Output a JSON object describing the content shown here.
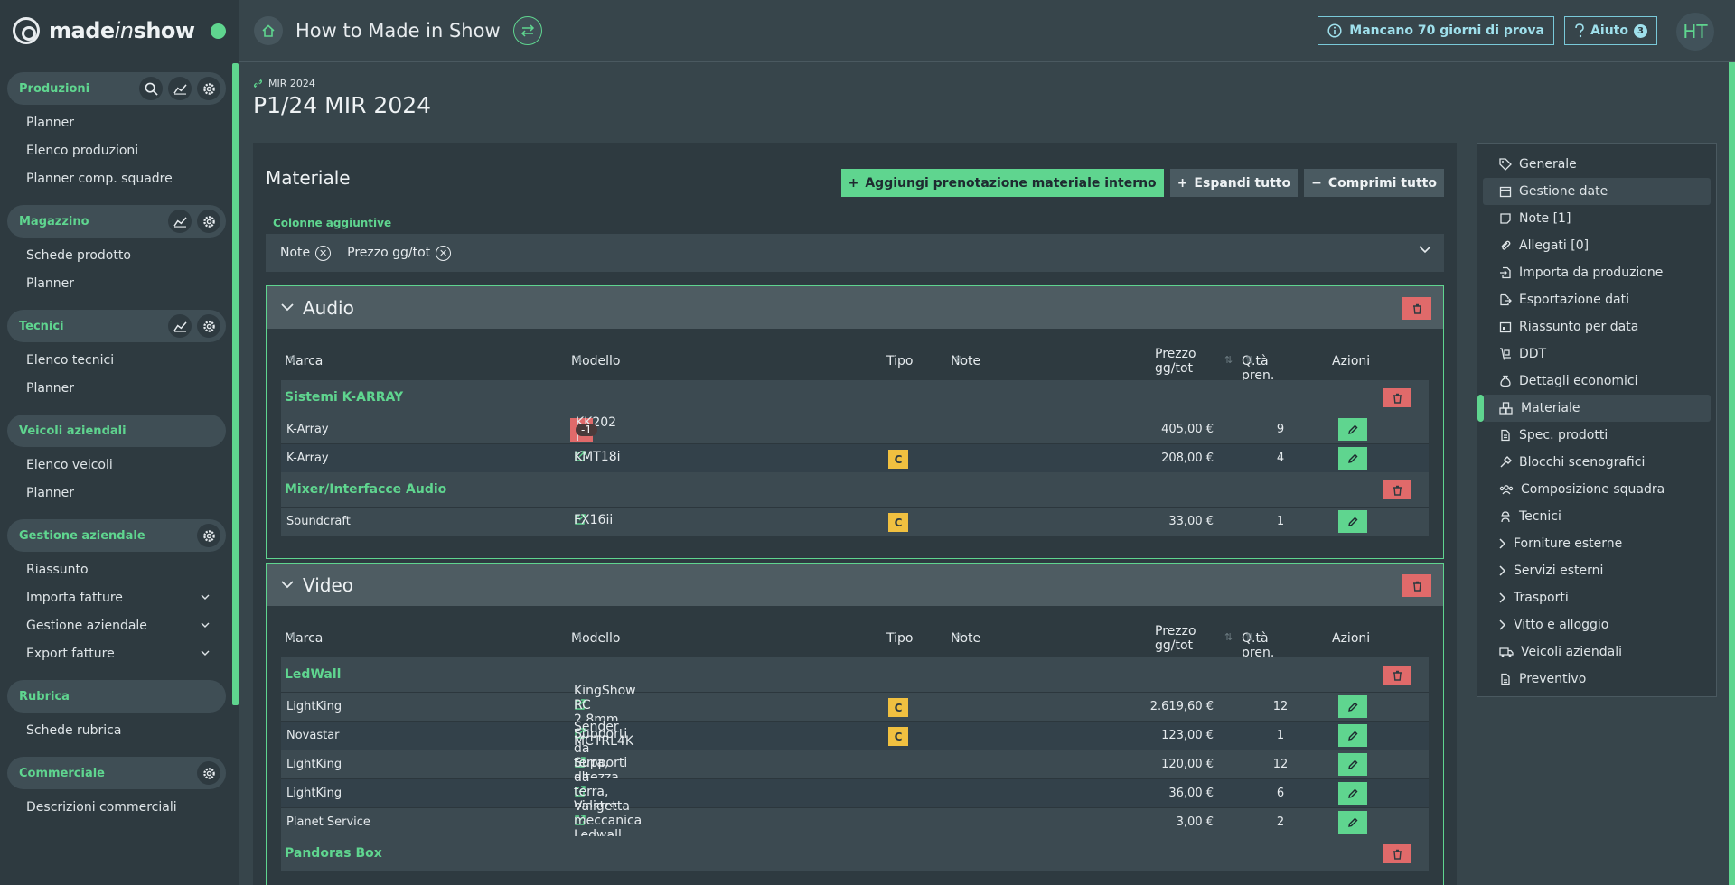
{
  "app": {
    "brand_a": "made",
    "brand_b": "in",
    "brand_c": "show",
    "title": "How to Made in Show",
    "trial": "Mancano 70 giorni di prova",
    "help": "Aiuto",
    "help_badge": "3",
    "avatar": "HT"
  },
  "sidebar": [
    {
      "title": "Produzioni",
      "items": [
        "Planner",
        "Elenco produzioni",
        "Planner comp. squadre"
      ]
    },
    {
      "title": "Magazzino",
      "items": [
        "Schede prodotto",
        "Planner"
      ]
    },
    {
      "title": "Tecnici",
      "items": [
        "Elenco tecnici",
        "Planner"
      ]
    },
    {
      "title": "Veicoli aziendali",
      "items": [
        "Elenco veicoli",
        "Planner"
      ]
    },
    {
      "title": "Gestione aziendale",
      "items": [
        "Riassunto",
        "Importa fatture",
        "Gestione aziendale",
        "Export fatture"
      ]
    },
    {
      "title": "Rubrica",
      "items": [
        "Schede rubrica"
      ]
    },
    {
      "title": "Commerciale",
      "items": [
        "Descrizioni commerciali"
      ]
    }
  ],
  "header": {
    "crumb": "MIR 2024",
    "title": "P1/24 MIR 2024"
  },
  "panel": {
    "title": "Materiale",
    "add_btn": "Aggiungi prenotazione materiale interno",
    "expand_btn": "Espandi tutto",
    "collapse_btn": "Comprimi tutto",
    "extra_label": "Colonne aggiuntive",
    "extra_chips": [
      "Note",
      "Prezzo gg/tot"
    ]
  },
  "columns": {
    "marca": "Marca",
    "modello": "Modello",
    "tipo": "Tipo",
    "note": "Note",
    "prezzo_a": "Prezzo",
    "prezzo_b": "gg/tot",
    "qta": "Q.tà pren.",
    "azioni": "Azioni"
  },
  "groups": [
    {
      "name": "Audio",
      "categories": [
        {
          "name": "Sistemi K-ARRAY",
          "rows": [
            {
              "marca": "K-Array",
              "modello": "KK202 I",
              "badge": "-1",
              "tipo": "",
              "prezzo": "405,00 €",
              "qta": "9"
            },
            {
              "marca": "K-Array",
              "modello": "KMT18i",
              "tipo": "C",
              "prezzo": "208,00 €",
              "qta": "4"
            }
          ]
        },
        {
          "name": "Mixer/Interfacce Audio",
          "rows": [
            {
              "marca": "Soundcraft",
              "modello": "FX16ii",
              "tipo": "C",
              "prezzo": "33,00 €",
              "qta": "1"
            }
          ]
        }
      ]
    },
    {
      "name": "Video",
      "categories": [
        {
          "name": "LedWall",
          "rows": [
            {
              "marca": "LightKing",
              "modello": "KingShow RC 2.8mm",
              "tipo": "C",
              "prezzo": "2.619,60 €",
              "qta": "12"
            },
            {
              "marca": "Novastar",
              "modello": "Sender MCTRL4K",
              "tipo": "C",
              "prezzo": "123,00 €",
              "qta": "1"
            },
            {
              "marca": "LightKing",
              "modello": "Supporti da terra, altezza 2m",
              "tipo": "",
              "prezzo": "120,00 €",
              "qta": "12"
            },
            {
              "marca": "LightKing",
              "modello": "Supporti da terra, piastra base",
              "tipo": "",
              "prezzo": "36,00 €",
              "qta": "6"
            },
            {
              "marca": "Planet Service",
              "modello": "Valigetta meccanica Ledwall",
              "tipo": "",
              "prezzo": "3,00 €",
              "qta": "2"
            }
          ]
        },
        {
          "name": "Pandoras Box",
          "rows": []
        }
      ]
    }
  ],
  "rnav": [
    "Generale",
    "Gestione date",
    "Note [1]",
    "Allegati [0]",
    "Importa da produzione",
    "Esportazione dati",
    "Riassunto per data",
    "DDT",
    "Dettagli economici",
    "Materiale",
    "Spec. prodotti",
    "Blocchi scenografici",
    "Composizione squadra",
    "Tecnici",
    "Forniture esterne",
    "Servizi esterni",
    "Trasporti",
    "Vitto e alloggio",
    "Veicoli aziendali",
    "Preventivo"
  ],
  "colors": {
    "accent": "#5fd58f",
    "danger": "#e06a6a",
    "warn": "#f0c040",
    "info": "#9fe0ec"
  }
}
